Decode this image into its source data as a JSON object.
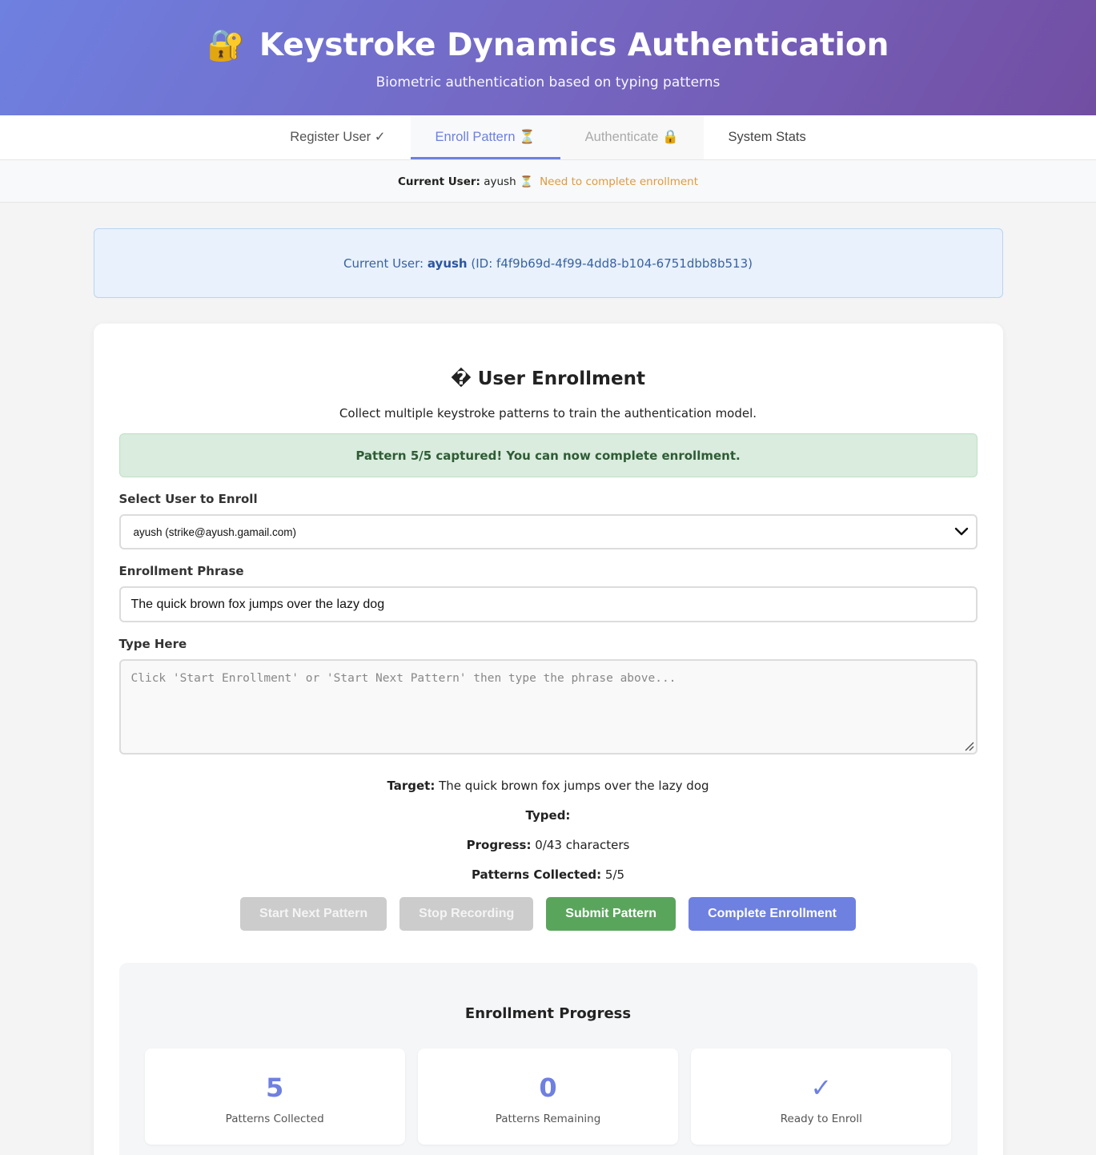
{
  "header": {
    "lock_icon": "🔐",
    "title": "Keystroke Dynamics Authentication",
    "subtitle": "Biometric authentication based on typing patterns"
  },
  "tabs": [
    {
      "label": "Register User ✓"
    },
    {
      "label": "Enroll Pattern ⏳"
    },
    {
      "label": "Authenticate 🔒"
    },
    {
      "label": "System Stats"
    }
  ],
  "user_status": {
    "label": "Current User:",
    "name": "ayush",
    "icon": "⏳",
    "message": "Need to complete enrollment"
  },
  "info_box": {
    "prefix": "Current User:",
    "name": "ayush",
    "id_text": "(ID: f4f9b69d-4f99-4dd8-b104-6751dbb8b513)"
  },
  "enrollment": {
    "title_icon": "�",
    "title": "User Enrollment",
    "description": "Collect multiple keystroke patterns to train the authentication model.",
    "success_message": "Pattern 5/5 captured! You can now complete enrollment.",
    "select_label": "Select User to Enroll",
    "select_value": "ayush (strike@ayush.gamail.com)",
    "phrase_label": "Enrollment Phrase",
    "phrase_value": "The quick brown fox jumps over the lazy dog",
    "type_label": "Type Here",
    "type_placeholder": "Click 'Start Enrollment' or 'Start Next Pattern' then type the phrase above...",
    "target_label": "Target:",
    "target_value": "The quick brown fox jumps over the lazy dog",
    "typed_label": "Typed:",
    "typed_value": "",
    "progress_label": "Progress:",
    "progress_value": "0/43 characters",
    "patterns_label": "Patterns Collected:",
    "patterns_value": "5/5"
  },
  "buttons": {
    "start_next": "Start Next Pattern",
    "stop_recording": "Stop Recording",
    "submit_pattern": "Submit Pattern",
    "complete_enrollment": "Complete Enrollment"
  },
  "progress": {
    "title": "Enrollment Progress",
    "cards": [
      {
        "value": "5",
        "label": "Patterns Collected"
      },
      {
        "value": "0",
        "label": "Patterns Remaining"
      },
      {
        "value": "✓",
        "label": "Ready to Enroll"
      }
    ]
  },
  "colors": {
    "accent": "#6e80e0",
    "success": "#5aa55c",
    "warning": "#e09a3e",
    "disabled": "#cccccc"
  }
}
